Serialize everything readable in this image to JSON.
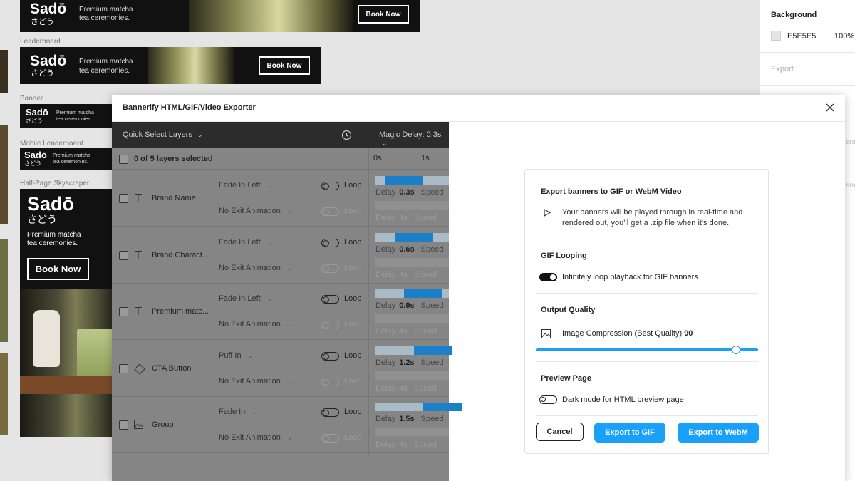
{
  "banners": {
    "brand": "Sadō",
    "brand_jp": "さどう",
    "tagline_l1": "Premium matcha",
    "tagline_l2": "tea ceremonies.",
    "cta": "Book Now",
    "labels": {
      "leaderboard": "Leaderboard",
      "banner": "Banner",
      "mobile_leaderboard": "Mobile Leaderboard",
      "half_page": "Half-Page Skyscraper"
    }
  },
  "right_panel": {
    "background_title": "Background",
    "bg_hex": "E5E5E5",
    "bg_opacity": "100%",
    "export_title": "Export",
    "peek_1": "anne",
    "peek_2": "ann"
  },
  "dialog": {
    "title": "Bannerify HTML/GIF/Video Exporter",
    "toolbar": {
      "quick_select": "Quick Select Layers",
      "magic_delay": "Magic Delay: 0.3s"
    },
    "selection": "0 of 5 layers selected",
    "timeline": {
      "t0": "0s",
      "t1": "1s"
    },
    "layers": [
      {
        "name": "Brand Name",
        "icon": "text-icon",
        "enter": "Fade In Left",
        "exit": "No Exit Animation",
        "loop": "Loop",
        "delay_label": "Delay",
        "delay": "0.3s",
        "speed_label": "Speed",
        "exit_delay": "4s",
        "bar_start": 0.2,
        "bar_width": 0.5
      },
      {
        "name": "Brand Charact...",
        "icon": "text-icon",
        "enter": "Fade In Left",
        "exit": "No Exit Animation",
        "loop": "Loop",
        "delay_label": "Delay",
        "delay": "0.6s",
        "speed_label": "Speed",
        "exit_delay": "4s",
        "bar_start": 0.4,
        "bar_width": 0.5
      },
      {
        "name": "Premium matc...",
        "icon": "text-icon",
        "enter": "Fade In Left",
        "exit": "No Exit Animation",
        "loop": "Loop",
        "delay_label": "Delay",
        "delay": "0.9s",
        "speed_label": "Speed",
        "exit_delay": "4s",
        "bar_start": 0.6,
        "bar_width": 0.5
      },
      {
        "name": "CTA Button",
        "icon": "component-icon",
        "enter": "Puff In",
        "exit": "No Exit Animation",
        "loop": "Loop",
        "delay_label": "Delay",
        "delay": "1.2s",
        "speed_label": "Speed",
        "exit_delay": "4s",
        "bar_start": 0.8,
        "bar_width": 0.5
      },
      {
        "name": "Group",
        "icon": "image-icon",
        "enter": "Fade In",
        "exit": "No Exit Animation",
        "loop": "Loop",
        "delay_label": "Delay",
        "delay": "1.5s",
        "speed_label": "Speed",
        "exit_delay": "4s",
        "bar_start": 1.0,
        "bar_width": 0.5
      }
    ],
    "export": {
      "heading": "Export banners to GIF or WebM Video",
      "desc_l1": "Your banners will be played through in real-time and",
      "desc_l2": "rendered out, you'll get a .zip file when it's done.",
      "gif_looping_title": "GIF Looping",
      "gif_looping_label": "Infinitely loop playback for GIF banners",
      "gif_looping_on": true,
      "quality_title": "Output Quality",
      "quality_label": "Image Compression (Best Quality)",
      "quality_value": "90",
      "quality_fraction": 0.9,
      "preview_title": "Preview Page",
      "preview_label": "Dark mode for HTML preview page",
      "preview_on": false,
      "cancel": "Cancel",
      "export_gif": "Export to GIF",
      "export_webm": "Export to WebM"
    }
  },
  "colors": {
    "accent": "#18A0FB",
    "canvas": "#E5E5E5",
    "toolbar": "#2C2C2C"
  }
}
